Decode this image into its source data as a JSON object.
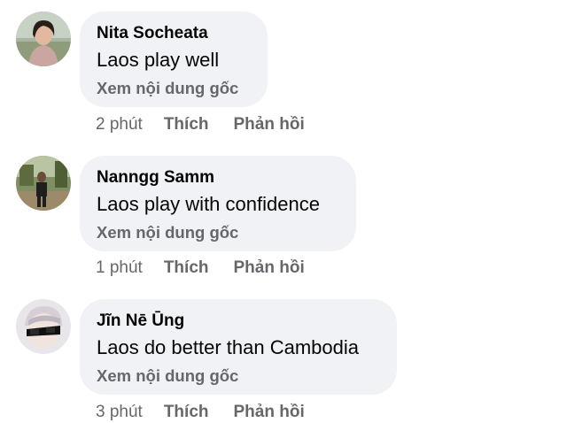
{
  "comments": [
    {
      "author": "Nita Socheata",
      "text": "Laos play well",
      "translate_label": "Xem nội dung gốc",
      "time": "2 phút",
      "like_label": "Thích",
      "reply_label": "Phản hồi",
      "avatar_icon": "user-photo-woman"
    },
    {
      "author": "Nanngg Samm",
      "text": "Laos play with confidence",
      "translate_label": "Xem nội dung gốc",
      "time": "1 phút",
      "like_label": "Thích",
      "reply_label": "Phản hồi",
      "avatar_icon": "user-photo-outdoor"
    },
    {
      "author": "Jĩn Nē Ūng",
      "text": "Laos do better than Cambodia",
      "translate_label": "Xem nội dung gốc",
      "time": "3 phút",
      "like_label": "Thích",
      "reply_label": "Phản hồi",
      "avatar_icon": "user-photo-sunglasses"
    }
  ],
  "colors": {
    "bubble": "#f0f2f5",
    "secondary_text": "#65676b",
    "primary_text": "#050505"
  }
}
